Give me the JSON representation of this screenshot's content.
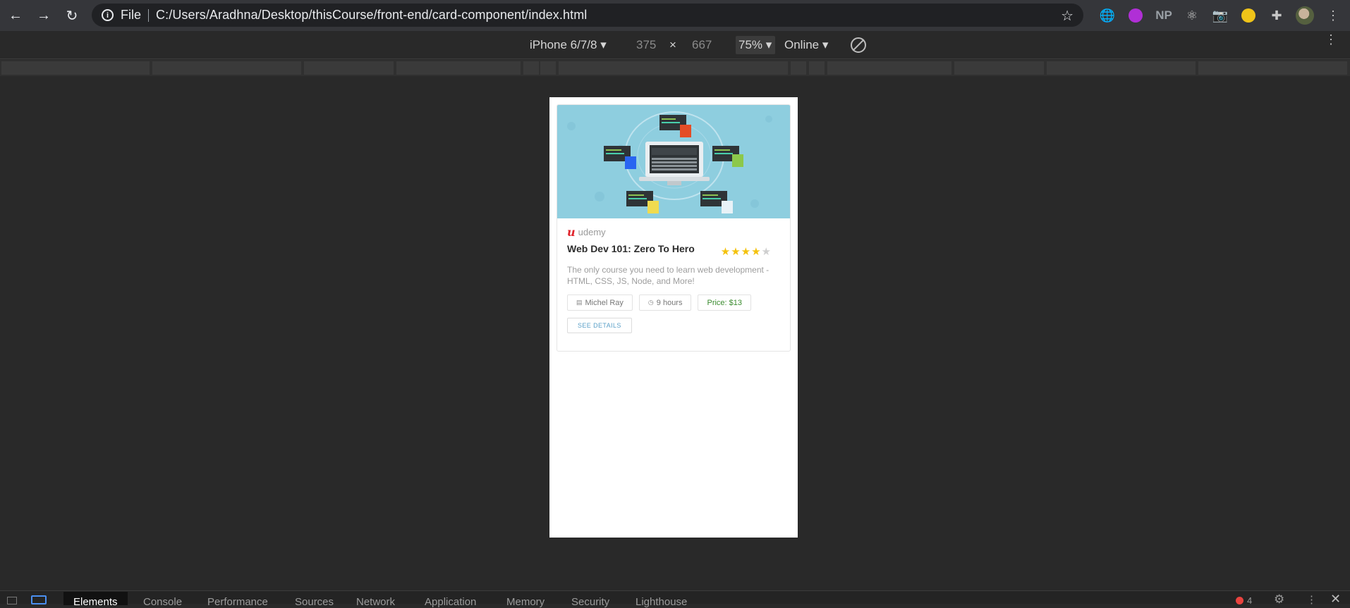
{
  "browser": {
    "back_icon": "arrow-left-icon",
    "forward_icon": "arrow-right-icon",
    "reload_icon": "reload-icon",
    "scheme": "File",
    "url": "C:/Users/Aradhna/Desktop/thisCourse/front-end/card-component/index.html",
    "extensions": [
      "globe-icon",
      "purple-extension-icon",
      "NP",
      "react-icon",
      "camera-icon",
      "eyes-icon",
      "puzzle-icon",
      "avatar"
    ],
    "np_label": "NP"
  },
  "device_toolbar": {
    "device": "iPhone 6/7/8",
    "width": "375",
    "times": "×",
    "height": "667",
    "zoom": "75%",
    "network": "Online"
  },
  "card": {
    "brand_logo": "u",
    "brand_name": "udemy",
    "title": "Web Dev 101: Zero To Hero",
    "rating": 3.5,
    "rating_max": 5,
    "description": "The only course you need to learn web development - HTML, CSS, JS, Node, and More!",
    "author": "Michel Ray",
    "duration": "9 hours",
    "price": "Price: $13",
    "details_label": "SEE DETAILS",
    "colors": {
      "banner": "#8ecedf",
      "brand": "#e0242c",
      "price": "#3a8b2e",
      "link": "#5aa0c8"
    }
  },
  "devtools": {
    "tabs": [
      "Elements",
      "Console",
      "Performance",
      "Sources",
      "Network",
      "Application",
      "Memory",
      "Security",
      "Lighthouse"
    ],
    "active_tab": "Elements",
    "error_count": "4"
  }
}
